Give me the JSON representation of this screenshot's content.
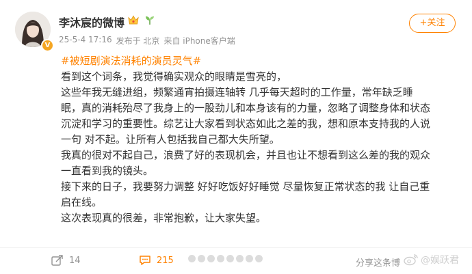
{
  "user": {
    "name": "李沐宸的微博",
    "avatar_alt": "avatar",
    "verified_badge": "V"
  },
  "meta": {
    "time": "25-5-4 17:16",
    "location": "发布于 北京",
    "source": "来自 iPhone客户端"
  },
  "follow_label": "+关注",
  "post": {
    "topic": "#被短剧演法消耗的演员灵气#",
    "lines": [
      "看到这个词条，我觉得确实观众的眼睛是雪亮的，",
      "这些年我无缝进组，频繁通宵拍摄连轴转 几乎每天超时的工作量，常年缺乏睡",
      "眠，真的消耗殆尽了我身上的一股劲儿和本身该有的力量，忽略了调整身体和状态",
      "沉淀和学习的重要性。综艺让大家看到状态如此之差的我，想和原本支持我的人说",
      "一句 对不起。让所有人包括我自己都大失所望。",
      "我真的很对不起自己，浪费了好的表现机会，并且也让不想看到这么差的我的观众",
      "一直看到我的镜头。",
      "接下来的日子，我要努力调整 好好吃饭好好睡觉 尽量恢复正常状态的我 让自己重",
      "启在线。",
      "这次表现真的很差，非常抱歉，让大家失望。"
    ]
  },
  "footer": {
    "share_count": "14",
    "comment_count": "215",
    "right_text": "分享这条博",
    "watermark": "@娱跃君"
  },
  "colors": {
    "accent": "#ff8200",
    "meta_gray": "#939393"
  },
  "icons": {
    "crown": "crown-icon",
    "sprout": "sprout-icon",
    "share": "share-icon",
    "comment": "comment-icon",
    "weibo": "weibo-logo-icon"
  }
}
